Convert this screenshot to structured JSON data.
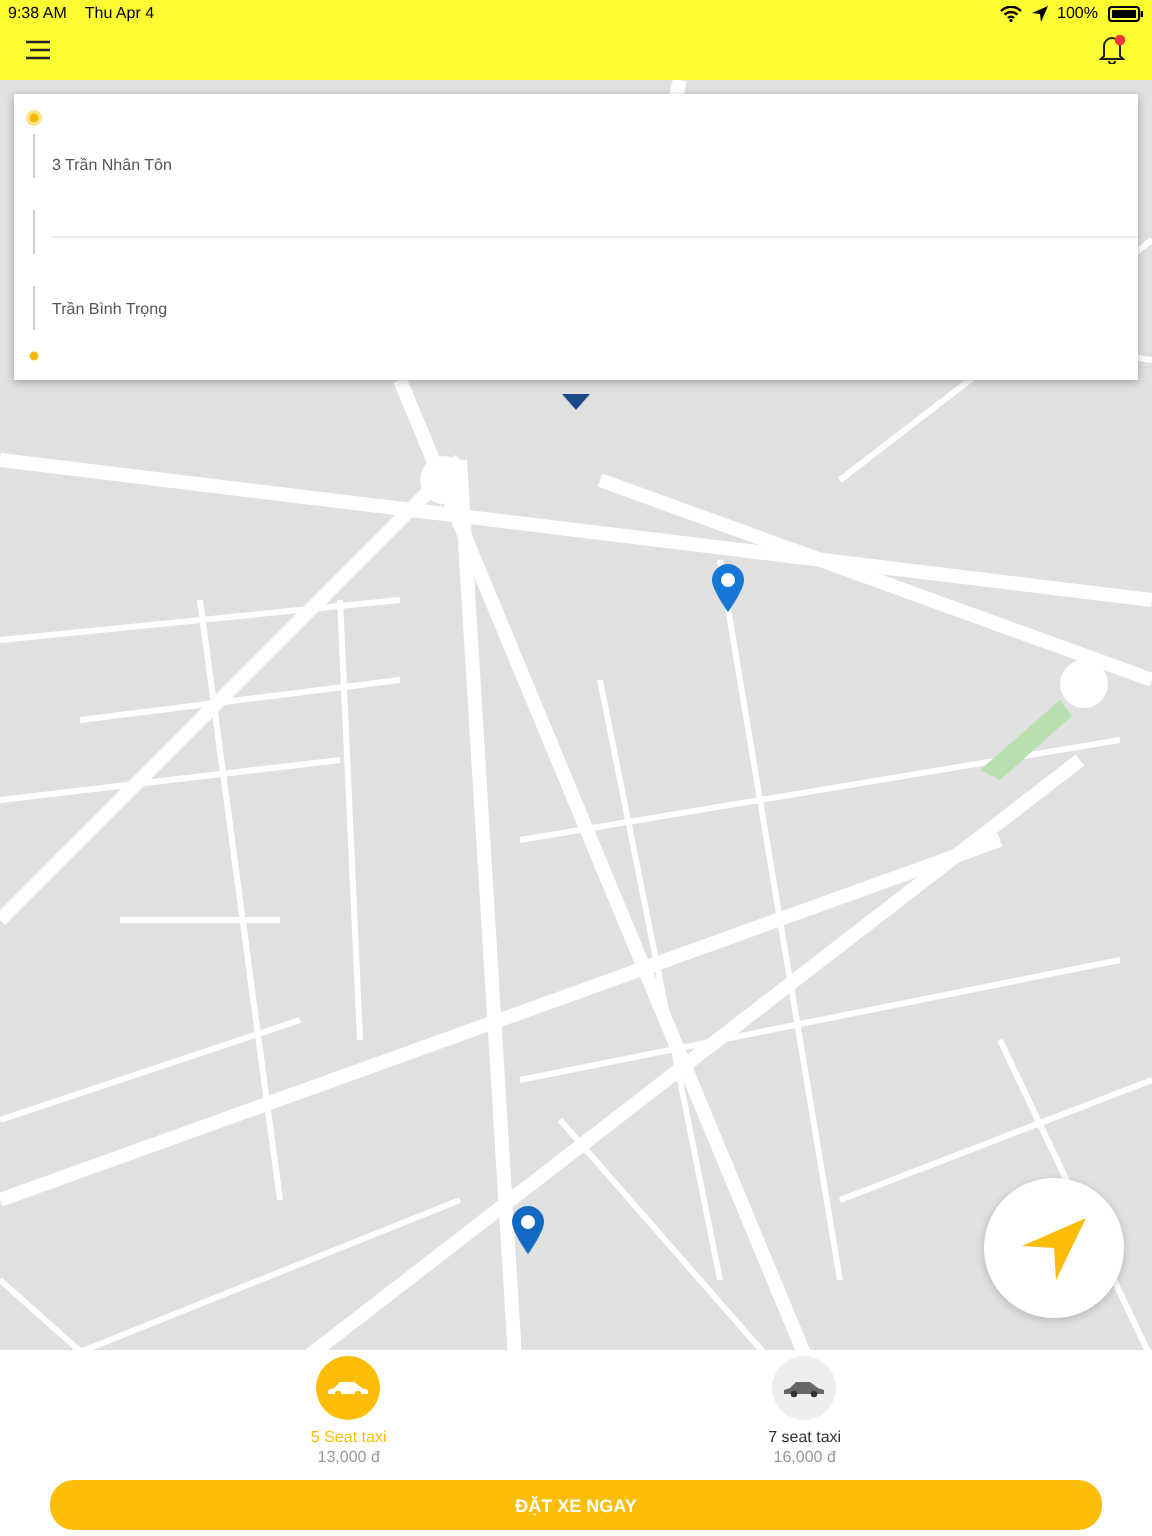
{
  "status_bar": {
    "time": "9:38 AM",
    "date": "Thu Apr 4",
    "battery": "100%"
  },
  "header": {
    "notification_unread": true
  },
  "route": {
    "stops": [
      {
        "address": "3 Trần Nhân Tôn"
      },
      {
        "address": "Trần Bình Trọng"
      }
    ]
  },
  "vehicles": [
    {
      "name": "5 Seat taxi",
      "price": "13,000 đ",
      "selected": true
    },
    {
      "name": "7 seat taxi",
      "price": "16,000 đ",
      "selected": false
    }
  ],
  "book_button": {
    "label": "ĐẶT XE NGAY"
  }
}
